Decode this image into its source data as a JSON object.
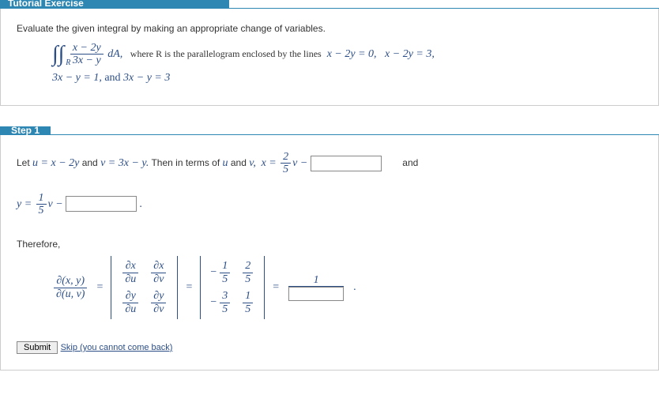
{
  "tabs": {
    "tutorial": "Tutorial Exercise",
    "step1": "Step 1"
  },
  "prompt": "Evaluate the given integral by making an appropriate change of variables.",
  "integral": {
    "num": "x − 2y",
    "den": "3x − y",
    "dA": "dA,",
    "where": "where R is the parallelogram enclosed by the lines",
    "line1": "x − 2y = 0,",
    "line2": "x − 2y = 3,",
    "line3": "3x − y = 1,",
    "and": " and ",
    "line4": "3x − y = 3"
  },
  "step": {
    "let": "Let",
    "uDef": "u = x − 2y",
    "andWord": "and",
    "vDef": "v = 3x − y.",
    "then": "Then in terms of",
    "uv": "u",
    "andWord2": "and",
    "vWord": "v,",
    "xEq": "x =",
    "xCoef_num": "2",
    "xCoef_den": "5",
    "xVar": "v −",
    "andTrail": "and",
    "yEq": "y =",
    "yCoef_num": "1",
    "yCoef_den": "5",
    "yVar": "v −",
    "dot": ".",
    "therefore": "Therefore,",
    "jac_num": "∂(x, y)",
    "jac_den": "∂(u, v)",
    "eq": "=",
    "m11_n": "1",
    "m11_d": "5",
    "m12_n": "2",
    "m12_d": "5",
    "m21_n": "3",
    "m21_d": "5",
    "m22_n": "1",
    "m22_d": "5",
    "one": "1",
    "dx": "∂x",
    "dy": "∂y",
    "du": "∂u",
    "dv": "∂v"
  },
  "actions": {
    "submit": "Submit",
    "skip": "Skip (you cannot come back)"
  }
}
